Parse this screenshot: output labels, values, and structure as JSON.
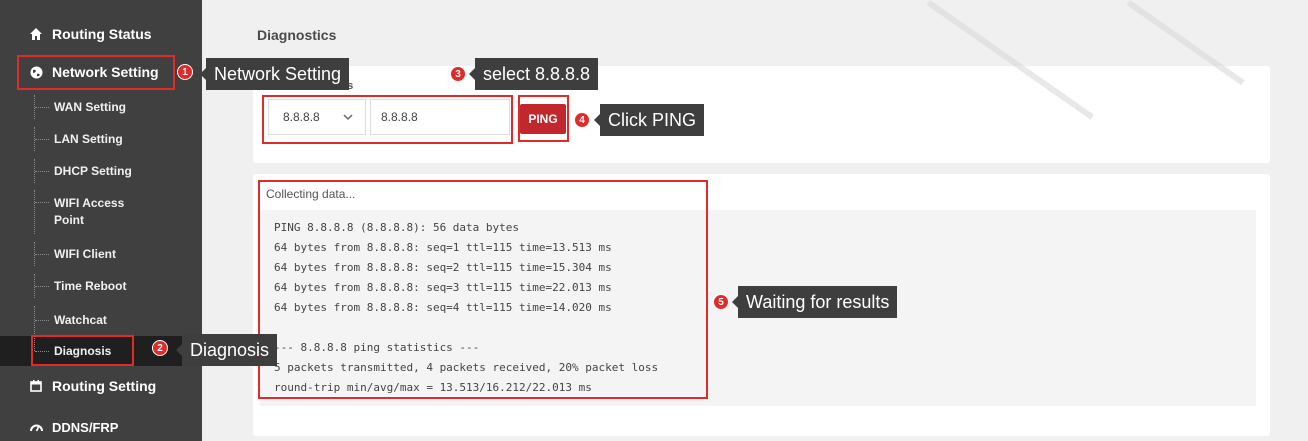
{
  "sidebar": {
    "routing_status": "Routing Status",
    "network_setting": "Network Setting",
    "sub_items": [
      "WAN Setting",
      "LAN Setting",
      "DHCP Setting",
      "WIFI Access Point",
      "WIFI Client",
      "Time Reboot",
      "Watchcat",
      "Diagnosis"
    ],
    "routing_setting": "Routing Setting",
    "ddns_frp": "DDNS/FRP"
  },
  "main": {
    "title": "Diagnostics",
    "utilities_title": "Network Utilities",
    "select_value": "8.8.8.8",
    "ip_value": "8.8.8.8",
    "ping_label": "PING",
    "collecting": "Collecting data...",
    "output_lines": [
      "PING 8.8.8.8 (8.8.8.8): 56 data bytes",
      "64 bytes from 8.8.8.8: seq=1 ttl=115 time=13.513 ms",
      "64 bytes from 8.8.8.8: seq=2 ttl=115 time=15.304 ms",
      "64 bytes from 8.8.8.8: seq=3 ttl=115 time=22.013 ms",
      "64 bytes from 8.8.8.8: seq=4 ttl=115 time=14.020 ms",
      "",
      "--- 8.8.8.8 ping statistics ---",
      "5 packets transmitted, 4 packets received, 20% packet loss",
      "round-trip min/avg/max = 13.513/16.212/22.013 ms"
    ]
  },
  "annotations": {
    "network_setting": {
      "num": "1",
      "text": "Network Setting"
    },
    "diagnosis": {
      "num": "2",
      "text": "Diagnosis"
    },
    "select": {
      "num": "3",
      "text": "select 8.8.8.8"
    },
    "ping": {
      "num": "4",
      "text": "Click PING"
    },
    "results": {
      "num": "5",
      "text": "Waiting for results"
    }
  },
  "colors": {
    "sidebar_bg": "#404040",
    "content_bg": "#f0f0f0",
    "ping_button": "#c1272d",
    "annotation_red": "#e02b2b",
    "callout_bg": "#3e3e3e"
  },
  "icons": {
    "routing_status": "home-icon",
    "network_setting": "globe-icon",
    "routing_setting": "calendar-icon",
    "ddns_frp": "gauge-icon",
    "select_chevron": "chevron-down-icon"
  }
}
